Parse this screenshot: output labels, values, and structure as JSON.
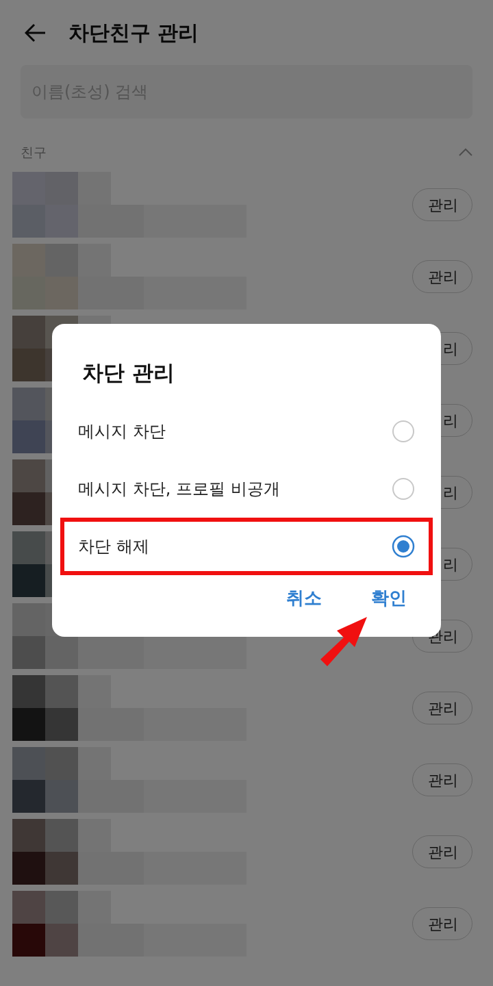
{
  "header": {
    "title": "차단친구 관리"
  },
  "search": {
    "placeholder": "이름(초성) 검색"
  },
  "section": {
    "title": "친구",
    "expanded": true
  },
  "rows": [
    {
      "button": "관리"
    },
    {
      "button": "관리"
    },
    {
      "button": "리"
    },
    {
      "button": "리"
    },
    {
      "button": "리"
    },
    {
      "button": "리"
    },
    {
      "button": "관리"
    },
    {
      "button": "관리"
    },
    {
      "button": "관리"
    },
    {
      "button": "관리"
    },
    {
      "button": "관리"
    }
  ],
  "dialog": {
    "title": "차단 관리",
    "options": [
      {
        "label": "메시지 차단",
        "selected": false
      },
      {
        "label": "메시지 차단, 프로필 비공개",
        "selected": false
      },
      {
        "label": "차단 해제",
        "selected": true
      }
    ],
    "buttons": [
      "취소",
      "확인"
    ]
  }
}
